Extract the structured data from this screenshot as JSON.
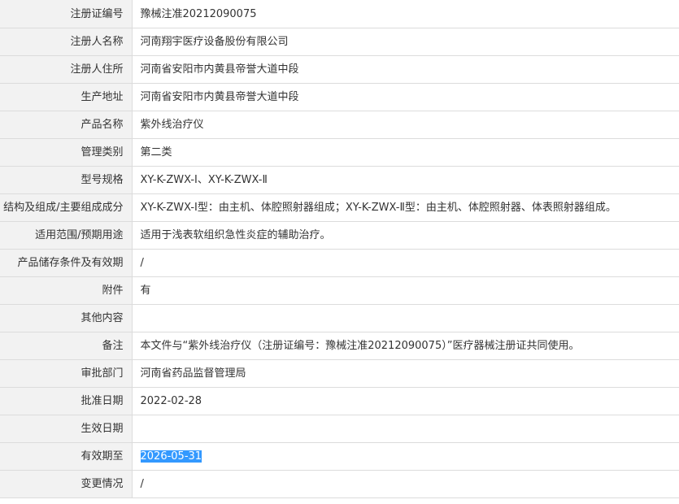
{
  "rows": [
    {
      "label": "注册证编号",
      "value": "豫械注准20212090075"
    },
    {
      "label": "注册人名称",
      "value": "河南翔宇医疗设备股份有限公司"
    },
    {
      "label": "注册人住所",
      "value": "河南省安阳市内黄县帝誉大道中段"
    },
    {
      "label": "生产地址",
      "value": "河南省安阳市内黄县帝誉大道中段"
    },
    {
      "label": "产品名称",
      "value": "紫外线治疗仪"
    },
    {
      "label": "管理类别",
      "value": "第二类"
    },
    {
      "label": "型号规格",
      "value": "XY-K-ZWX-Ⅰ、XY-K-ZWX-Ⅱ"
    },
    {
      "label": "结构及组成/主要组成成分",
      "value": "XY-K-ZWX-Ⅰ型：由主机、体腔照射器组成；XY-K-ZWX-Ⅱ型：由主机、体腔照射器、体表照射器组成。"
    },
    {
      "label": "适用范围/预期用途",
      "value": "适用于浅表软组织急性炎症的辅助治疗。"
    },
    {
      "label": "产品储存条件及有效期",
      "value": "/"
    },
    {
      "label": "附件",
      "value": "有"
    },
    {
      "label": "其他内容",
      "value": ""
    },
    {
      "label": "备注",
      "value": "本文件与“紫外线治疗仪（注册证编号：豫械注准20212090075）”医疗器械注册证共同使用。"
    },
    {
      "label": "审批部门",
      "value": "河南省药品监督管理局"
    },
    {
      "label": "批准日期",
      "value": "2022-02-28"
    },
    {
      "label": "生效日期",
      "value": ""
    },
    {
      "label": "有效期至",
      "value": "2026-05-31"
    },
    {
      "label": "变更情况",
      "value": "/"
    }
  ]
}
